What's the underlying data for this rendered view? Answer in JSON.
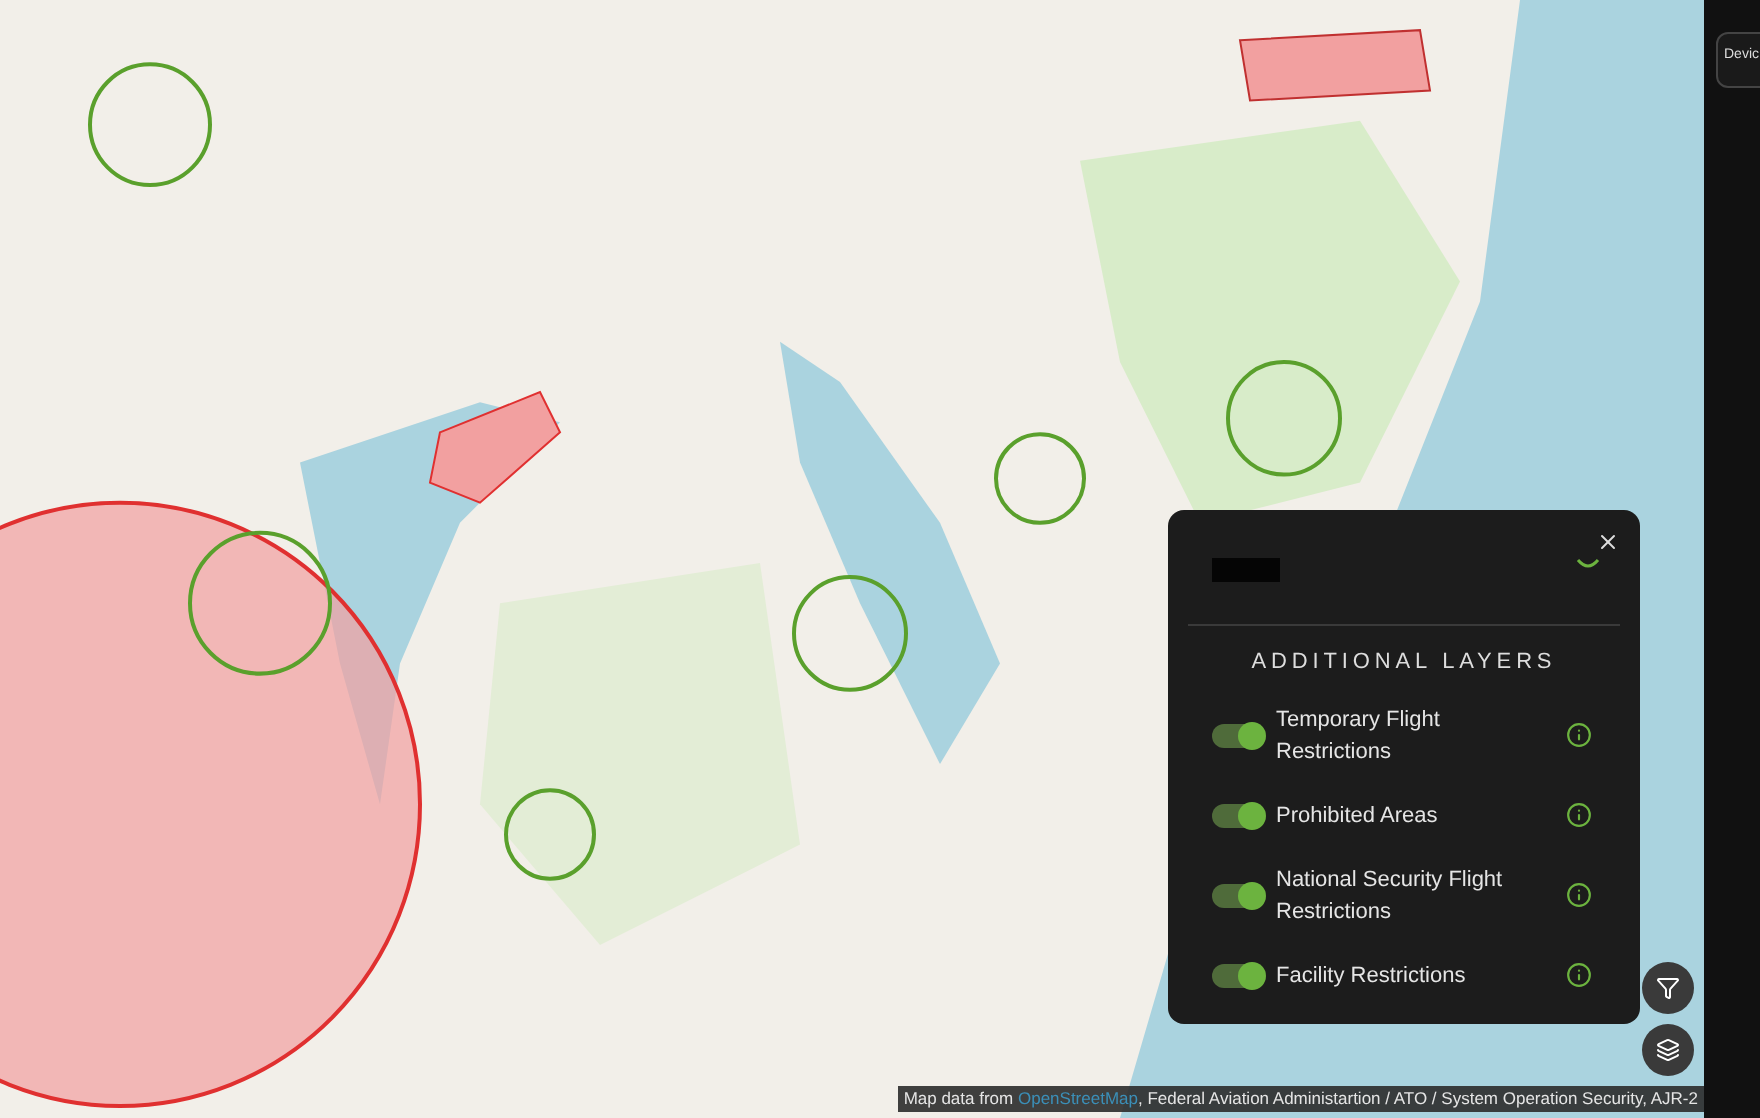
{
  "side_button": {
    "label": "Devic"
  },
  "layers_panel": {
    "title": "ADDITIONAL LAYERS",
    "layers": [
      {
        "label": "Temporary Flight Restrictions",
        "on": true
      },
      {
        "label": "Prohibited Areas",
        "on": true
      },
      {
        "label": "National Security Flight Restrictions",
        "on": true
      },
      {
        "label": "Facility Restrictions",
        "on": true
      }
    ]
  },
  "attribution": {
    "prefix": "Map data from ",
    "link": "OpenStreetMap",
    "suffix": ", Federal Aviation Administartion / ATO / System Operation Security, AJR-2"
  }
}
